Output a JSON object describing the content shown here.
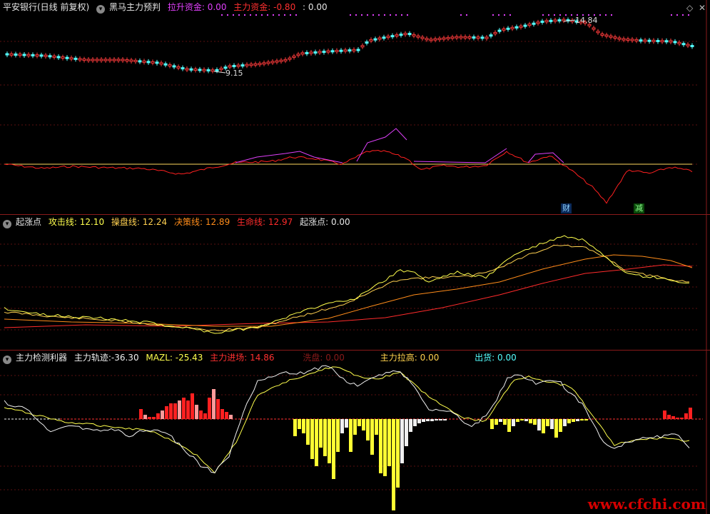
{
  "top_panel": {
    "title": "平安银行(日线 前复权)",
    "indicator_name": "黑马主力预判",
    "legend": [
      {
        "label": "拉升资金:",
        "value": "0.00",
        "color": "#e040fb"
      },
      {
        "label": "主力资金:",
        "value": "-0.80",
        "color": "#ff3030"
      },
      {
        "label": ":",
        "value": "0.00",
        "color": "#e6e6e6"
      }
    ],
    "low_label": "9.15",
    "high_label": "14.84",
    "events": [
      {
        "text": "财",
        "color": "#8fd3ff",
        "bg": "#0a2a5a"
      },
      {
        "text": "减",
        "color": "#8fff8f",
        "bg": "#0a4a0a"
      }
    ],
    "controls": {
      "diamond": "◇",
      "close": "✕"
    },
    "colors": {
      "up": "#ff3b3b",
      "down": "#54ffff",
      "fund_line": "#ff2020",
      "lift_line": "#e040fb",
      "zero_line": "#ffd75e",
      "dots": "#e040fb"
    }
  },
  "mid_panel": {
    "indicator_name": "起涨点",
    "legend": [
      {
        "label": "攻击线:",
        "value": "12.10",
        "color": "#ffff4d"
      },
      {
        "label": "操盘线:",
        "value": "12.24",
        "color": "#ffd050"
      },
      {
        "label": "决策线:",
        "value": "12.89",
        "color": "#ff8c1a"
      },
      {
        "label": "生命线:",
        "value": "12.97",
        "color": "#ff2b2b"
      },
      {
        "label": "起涨点:",
        "value": "0.00",
        "color": "#e6e6e6"
      }
    ]
  },
  "bottom_panel": {
    "indicator_name": "主力检测利器",
    "legend": [
      {
        "label": "主力轨迹:",
        "value": "-36.30",
        "color": "#f0f0f0"
      },
      {
        "label": "MAZL:",
        "value": "-25.43",
        "color": "#ffff4d"
      },
      {
        "label": "主力进场:",
        "value": "14.86",
        "color": "#ff3030"
      },
      {
        "label": "洗盘:",
        "value": "0.00",
        "color": "#8a1a1a"
      },
      {
        "label": "主力拉高:",
        "value": "0.00",
        "color": "#ffd24d"
      },
      {
        "label": "出货:",
        "value": "0.00",
        "color": "#54ffff"
      }
    ]
  },
  "watermark": "www.cfchi.com"
}
